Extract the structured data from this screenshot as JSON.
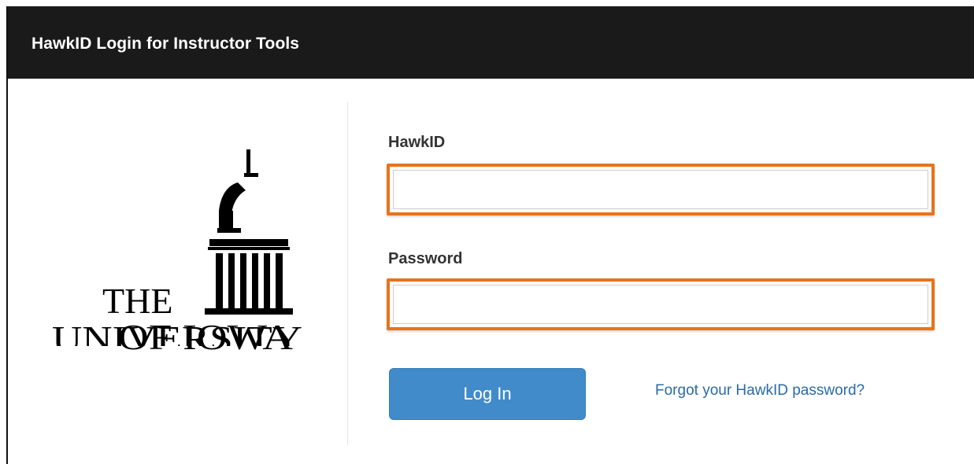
{
  "header": {
    "title": "HawkID Login for Instructor Tools"
  },
  "logo": {
    "line1": "THE",
    "line2": "UNIVERSITY",
    "line3": "OF IOWA"
  },
  "form": {
    "hawkid_label": "HawkID",
    "hawkid_value": "",
    "password_label": "Password",
    "password_value": "",
    "login_label": "Log In",
    "forgot_label": "Forgot your HawkID password?"
  },
  "colors": {
    "header_bg": "#1a1a1a",
    "highlight": "#e8731a",
    "button_bg": "#428bca",
    "link": "#2a6aa6"
  }
}
